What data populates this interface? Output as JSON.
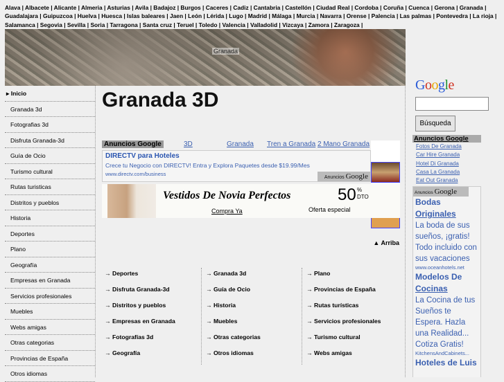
{
  "provinces": [
    "Alava",
    "Albacete",
    "Alicante",
    "Almeria",
    "Asturias",
    "Avila",
    "Badajoz",
    "Burgos",
    "Caceres",
    "Cadiz",
    "Cantabria",
    "Castellón",
    "Ciudad Real",
    "Cordoba",
    "Coruña",
    "Cuenca",
    "Gerona",
    "Granada",
    "Guadalajara",
    "Guipuzcoa",
    "Huelva",
    "Huesca",
    "Islas baleares",
    "Jaen",
    "León",
    "Lérida",
    "Lugo",
    "Madrid",
    "Málaga",
    "Murcia",
    "Navarra",
    "Orense",
    "Palencia",
    "Las palmas",
    "Pontevedra",
    "La rioja",
    "Salamanca",
    "Segovia",
    "Sevilla",
    "Soria",
    "Tarragona",
    "Santa cruz",
    "Teruel",
    "Toledo",
    "Valencia",
    "Valladolid",
    "Vizcaya",
    "Zamora",
    "Zaragoza"
  ],
  "banner": {
    "label": "Granada"
  },
  "sidebar": {
    "items": [
      "Inicio",
      "Granada 3d",
      "Fotografias 3d",
      "Disfruta Granada-3d",
      "Guía de Ocio",
      "Turismo cultural",
      "Rutas turisticas",
      "Distritos y pueblos",
      "Historia",
      "Deportes",
      "Plano",
      "Geografía",
      "Empresas en Granada",
      "Servicios profesionales",
      "Muebles",
      "Webs amigas",
      "Otras categorias",
      "Provincias de España",
      "Otros idiomas"
    ]
  },
  "main": {
    "title": "Granada 3D",
    "ad_links": {
      "label": "Anuncios Google",
      "links": [
        "3D",
        "Granada",
        "Tren a Granada",
        "2 Mano Granada"
      ]
    },
    "ad": {
      "headline": "DIRECTV para Hoteles",
      "desc": "Crece tu Negocio con DIRECTV! Entra y Explora Paquetes desde $19.99/Mes",
      "url": "www.directv.com/business",
      "badge_a": "Anuncios",
      "badge_b": "Google"
    },
    "bridal": {
      "title": "Vestidos De Novia Perfectos",
      "pct": "50",
      "pct_sign": "%",
      "dto": "DTO",
      "cta": "Compra Ya",
      "offer": "Oferta especial"
    },
    "arriba": "▲ Arriba",
    "columns": [
      [
        "Deportes",
        "Disfruta Granada-3d",
        "Distritos y pueblos",
        "Empresas en Granada",
        "Fotografías 3d",
        "Geografía"
      ],
      [
        "Granada 3d",
        "Guía de Ocio",
        "Historia",
        "Muebles",
        "Otras categorias",
        "Otros idiomas"
      ],
      [
        "Plano",
        "Provincias de España",
        "Rutas turísticas",
        "Servicios profesionales",
        "Turismo cultural",
        "Webs amigas"
      ]
    ]
  },
  "search": {
    "logo": [
      "G",
      "o",
      "o",
      "g",
      "l",
      "e"
    ],
    "button": "Búsqueda",
    "value": ""
  },
  "right_links": {
    "label": "Anuncios Google",
    "links": [
      "Fotos De Granada",
      "Car Hire Granada",
      "Hotel Di Granada",
      "Casa La Granada",
      "Eat Out Granada"
    ]
  },
  "right_ads": {
    "badge_a": "Anuncios",
    "badge_b": "Google",
    "ads": [
      {
        "h1": "Bodas",
        "h2": "Originales",
        "desc": "La boda de sus sueños, ¡gratis! Todo incluido con sus vacaciones",
        "url": "www.oceanhotels.net"
      },
      {
        "h1": "Modelos De",
        "h2": "Cocinas",
        "desc": "La Cocina de tus Sueños te Espera. Hazla una Realidad... Cotiza Gratis!",
        "url": "KitchensAndCabinets..."
      },
      {
        "h1": "Hoteles de Luis",
        "h2": "",
        "desc": "",
        "url": ""
      }
    ]
  }
}
